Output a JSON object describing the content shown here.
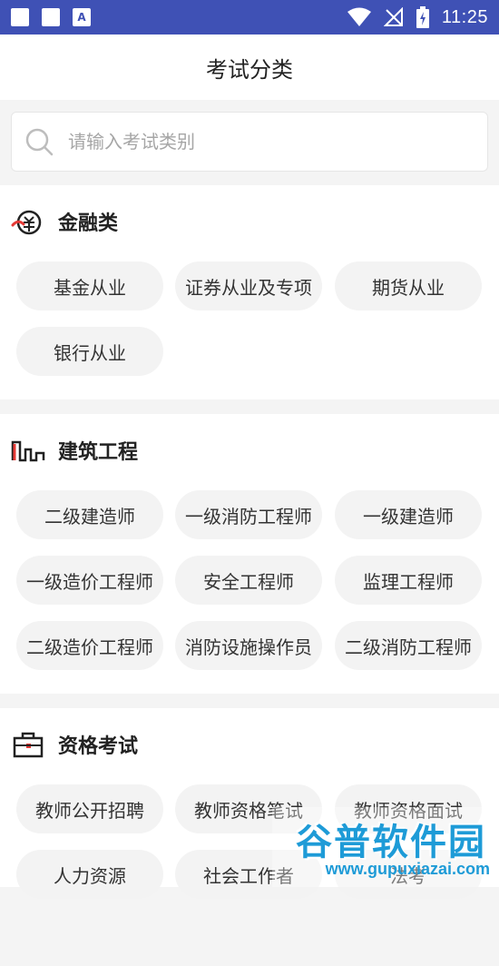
{
  "status_bar": {
    "time": "11:25"
  },
  "header": {
    "title": "考试分类"
  },
  "search": {
    "placeholder": "请输入考试类别"
  },
  "sections": [
    {
      "title": "金融类",
      "icon": "finance-coin-icon",
      "items": [
        "基金从业",
        "证券从业及专项",
        "期货从业",
        "银行从业"
      ]
    },
    {
      "title": "建筑工程",
      "icon": "construction-icon",
      "items": [
        "二级建造师",
        "一级消防工程师",
        "一级建造师",
        "一级造价工程师",
        "安全工程师",
        "监理工程师",
        "二级造价工程师",
        "消防设施操作员",
        "二级消防工程师"
      ]
    },
    {
      "title": "资格考试",
      "icon": "briefcase-icon",
      "items": [
        "教师公开招聘",
        "教师资格笔试",
        "教师资格面试",
        "人力资源",
        "社会工作者",
        "法考"
      ]
    }
  ],
  "watermark": {
    "text": "谷普软件园",
    "url": "www.gupuxiazai.com"
  },
  "colors": {
    "status_bar": "#3f51b5",
    "accent_red": "#e53935",
    "watermark": "#1e9bd7"
  }
}
